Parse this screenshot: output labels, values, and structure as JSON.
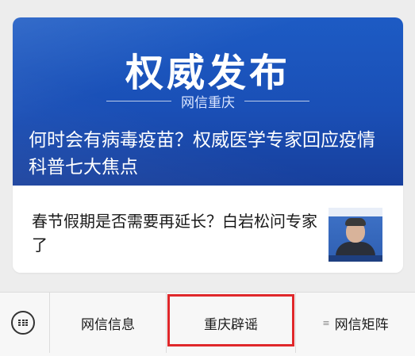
{
  "article_card": {
    "hero": {
      "title": "权威发布",
      "subtitle": "网信重庆",
      "headline": "何时会有病毒疫苗？权威医学专家回应疫情科普七大焦点"
    },
    "secondary": {
      "headline": "春节假期是否需要再延长？白岩松问专家了"
    }
  },
  "menu_bar": {
    "tabs": [
      {
        "label": "网信信息"
      },
      {
        "label": "重庆辟谣"
      },
      {
        "label": "网信矩阵",
        "icon": "list-menu-icon"
      }
    ],
    "keyboard_icon": "keyboard-icon"
  },
  "colors": {
    "hero_blue": "#1a4fb6",
    "highlight_red": "#e0282b"
  }
}
